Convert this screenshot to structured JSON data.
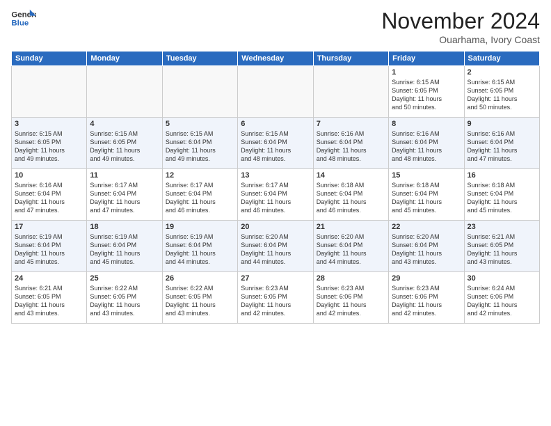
{
  "header": {
    "logo_line1": "General",
    "logo_line2": "Blue",
    "title": "November 2024",
    "location": "Ouarhama, Ivory Coast"
  },
  "days_of_week": [
    "Sunday",
    "Monday",
    "Tuesday",
    "Wednesday",
    "Thursday",
    "Friday",
    "Saturday"
  ],
  "weeks": [
    [
      {
        "day": "",
        "info": ""
      },
      {
        "day": "",
        "info": ""
      },
      {
        "day": "",
        "info": ""
      },
      {
        "day": "",
        "info": ""
      },
      {
        "day": "",
        "info": ""
      },
      {
        "day": "1",
        "info": "Sunrise: 6:15 AM\nSunset: 6:05 PM\nDaylight: 11 hours\nand 50 minutes."
      },
      {
        "day": "2",
        "info": "Sunrise: 6:15 AM\nSunset: 6:05 PM\nDaylight: 11 hours\nand 50 minutes."
      }
    ],
    [
      {
        "day": "3",
        "info": "Sunrise: 6:15 AM\nSunset: 6:05 PM\nDaylight: 11 hours\nand 49 minutes."
      },
      {
        "day": "4",
        "info": "Sunrise: 6:15 AM\nSunset: 6:05 PM\nDaylight: 11 hours\nand 49 minutes."
      },
      {
        "day": "5",
        "info": "Sunrise: 6:15 AM\nSunset: 6:04 PM\nDaylight: 11 hours\nand 49 minutes."
      },
      {
        "day": "6",
        "info": "Sunrise: 6:15 AM\nSunset: 6:04 PM\nDaylight: 11 hours\nand 48 minutes."
      },
      {
        "day": "7",
        "info": "Sunrise: 6:16 AM\nSunset: 6:04 PM\nDaylight: 11 hours\nand 48 minutes."
      },
      {
        "day": "8",
        "info": "Sunrise: 6:16 AM\nSunset: 6:04 PM\nDaylight: 11 hours\nand 48 minutes."
      },
      {
        "day": "9",
        "info": "Sunrise: 6:16 AM\nSunset: 6:04 PM\nDaylight: 11 hours\nand 47 minutes."
      }
    ],
    [
      {
        "day": "10",
        "info": "Sunrise: 6:16 AM\nSunset: 6:04 PM\nDaylight: 11 hours\nand 47 minutes."
      },
      {
        "day": "11",
        "info": "Sunrise: 6:17 AM\nSunset: 6:04 PM\nDaylight: 11 hours\nand 47 minutes."
      },
      {
        "day": "12",
        "info": "Sunrise: 6:17 AM\nSunset: 6:04 PM\nDaylight: 11 hours\nand 46 minutes."
      },
      {
        "day": "13",
        "info": "Sunrise: 6:17 AM\nSunset: 6:04 PM\nDaylight: 11 hours\nand 46 minutes."
      },
      {
        "day": "14",
        "info": "Sunrise: 6:18 AM\nSunset: 6:04 PM\nDaylight: 11 hours\nand 46 minutes."
      },
      {
        "day": "15",
        "info": "Sunrise: 6:18 AM\nSunset: 6:04 PM\nDaylight: 11 hours\nand 45 minutes."
      },
      {
        "day": "16",
        "info": "Sunrise: 6:18 AM\nSunset: 6:04 PM\nDaylight: 11 hours\nand 45 minutes."
      }
    ],
    [
      {
        "day": "17",
        "info": "Sunrise: 6:19 AM\nSunset: 6:04 PM\nDaylight: 11 hours\nand 45 minutes."
      },
      {
        "day": "18",
        "info": "Sunrise: 6:19 AM\nSunset: 6:04 PM\nDaylight: 11 hours\nand 45 minutes."
      },
      {
        "day": "19",
        "info": "Sunrise: 6:19 AM\nSunset: 6:04 PM\nDaylight: 11 hours\nand 44 minutes."
      },
      {
        "day": "20",
        "info": "Sunrise: 6:20 AM\nSunset: 6:04 PM\nDaylight: 11 hours\nand 44 minutes."
      },
      {
        "day": "21",
        "info": "Sunrise: 6:20 AM\nSunset: 6:04 PM\nDaylight: 11 hours\nand 44 minutes."
      },
      {
        "day": "22",
        "info": "Sunrise: 6:20 AM\nSunset: 6:04 PM\nDaylight: 11 hours\nand 43 minutes."
      },
      {
        "day": "23",
        "info": "Sunrise: 6:21 AM\nSunset: 6:05 PM\nDaylight: 11 hours\nand 43 minutes."
      }
    ],
    [
      {
        "day": "24",
        "info": "Sunrise: 6:21 AM\nSunset: 6:05 PM\nDaylight: 11 hours\nand 43 minutes."
      },
      {
        "day": "25",
        "info": "Sunrise: 6:22 AM\nSunset: 6:05 PM\nDaylight: 11 hours\nand 43 minutes."
      },
      {
        "day": "26",
        "info": "Sunrise: 6:22 AM\nSunset: 6:05 PM\nDaylight: 11 hours\nand 43 minutes."
      },
      {
        "day": "27",
        "info": "Sunrise: 6:23 AM\nSunset: 6:05 PM\nDaylight: 11 hours\nand 42 minutes."
      },
      {
        "day": "28",
        "info": "Sunrise: 6:23 AM\nSunset: 6:06 PM\nDaylight: 11 hours\nand 42 minutes."
      },
      {
        "day": "29",
        "info": "Sunrise: 6:23 AM\nSunset: 6:06 PM\nDaylight: 11 hours\nand 42 minutes."
      },
      {
        "day": "30",
        "info": "Sunrise: 6:24 AM\nSunset: 6:06 PM\nDaylight: 11 hours\nand 42 minutes."
      }
    ]
  ]
}
